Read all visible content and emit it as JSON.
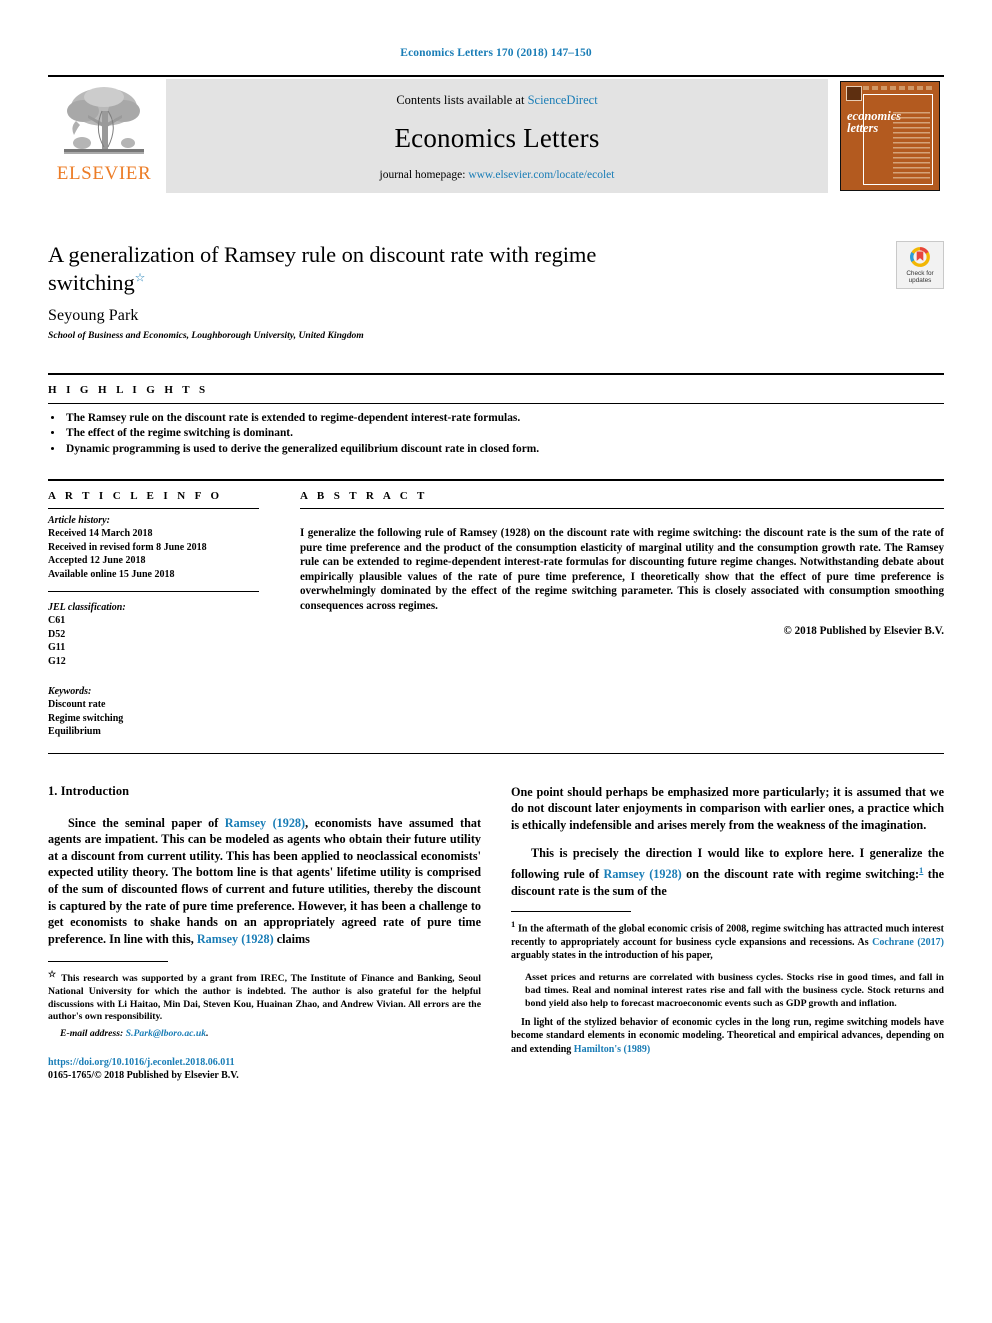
{
  "running_head": "Economics Letters 170 (2018) 147–150",
  "masthead": {
    "publisher_name": "ELSEVIER",
    "contents_prefix": "Contents lists available at",
    "contents_link": "ScienceDirect",
    "journal_title": "Economics Letters",
    "homepage_prefix": "journal homepage:",
    "homepage_link": "www.elsevier.com/locate/ecolet",
    "cover_title_line1": "economics",
    "cover_title_line2": "letters"
  },
  "article": {
    "title": "A generalization of Ramsey rule on discount rate with regime switching",
    "title_star": "☆",
    "author": "Seyoung Park",
    "affiliation": "School of Business and Economics, Loughborough University, United Kingdom",
    "crossmark_line1": "Check for",
    "crossmark_line2": "updates"
  },
  "highlights": {
    "heading": "H I G H L I G H T S",
    "items": [
      "The Ramsey rule on the discount rate is extended to regime-dependent interest-rate formulas.",
      "The effect of the regime switching is dominant.",
      "Dynamic programming is used to derive the generalized equilibrium discount rate in closed form."
    ]
  },
  "article_info": {
    "heading": "A R T I C L E    I N F O",
    "history_label": "Article history:",
    "history": [
      "Received 14 March 2018",
      "Received in revised form 8 June 2018",
      "Accepted 12 June 2018",
      "Available online 15 June 2018"
    ],
    "jel_label": "JEL classification:",
    "jel_codes": [
      "C61",
      "D52",
      "G11",
      "G12"
    ],
    "keywords_label": "Keywords:",
    "keywords": [
      "Discount rate",
      "Regime switching",
      "Equilibrium"
    ]
  },
  "abstract": {
    "heading": "A B S T R A C T",
    "text": "I generalize the following rule of Ramsey (1928) on the discount rate with regime switching: the discount rate is the sum of the rate of pure time preference and the product of the consumption elasticity of marginal utility and the consumption growth rate. The Ramsey rule can be extended to regime-dependent interest-rate formulas for discounting future regime changes. Notwithstanding debate about empirically plausible values of the rate of pure time preference, I theoretically show that the effect of pure time preference is overwhelmingly dominated by the effect of the regime switching parameter. This is closely associated with consumption smoothing consequences across regimes.",
    "copyright": "© 2018 Published by Elsevier B.V."
  },
  "body": {
    "section_heading": "1. Introduction",
    "left_paragraph_parts": {
      "p1_a": "Since the seminal paper of ",
      "p1_cite_author": "Ramsey",
      "p1_cite_year": "(1928)",
      "p1_b": ", economists have assumed that agents are impatient. This can be modeled as agents who obtain their future utility at a discount from current utility. This has been applied to neoclassical economists' expected utility theory. The bottom line is that agents' lifetime utility is comprised of the sum of discounted flows of current and future utilities, thereby the discount is captured by the rate of pure time preference. However, it has been a challenge to get economists to shake hands on an appropriately agreed rate of pure time preference. In line with this, ",
      "p1_cite2_author": "Ramsey",
      "p1_cite2_year": "(1928)",
      "p1_c": " claims"
    },
    "right_quote": "One point should perhaps be emphasized more particularly; it is assumed that we do not discount later enjoyments in comparison with earlier ones, a practice which is ethically indefensible and arises merely from the weakness of the imagination.",
    "right_paragraph_parts": {
      "p2_a": "This is precisely the direction I would like to explore here. I generalize the following rule of ",
      "p2_cite_author": "Ramsey",
      "p2_cite_year": "(1928)",
      "p2_b": " on the discount rate with regime switching:",
      "p2_note": "1",
      "p2_c": " the discount rate is the sum of the"
    }
  },
  "footnotes": {
    "left_star_marker": "☆",
    "left_star_text": "This research was supported by a grant from IREC, The Institute of Finance and Banking, Seoul National University for which the author is indebted. The author is also grateful for the helpful discussions with Li Haitao, Min Dai, Steven Kou, Huainan Zhao, and Andrew Vivian. All errors are the author's own responsibility.",
    "email_label": "E-mail address:",
    "email": "S.Park@lboro.ac.uk",
    "doi": "https://doi.org/10.1016/j.econlet.2018.06.011",
    "issn_line": "0165-1765/© 2018 Published by Elsevier B.V.",
    "right_marker": "1",
    "right_text_a": "In the aftermath of the global economic crisis of 2008, regime switching has attracted much interest recently to appropriately account for business cycle expansions and recessions. As ",
    "right_cite_author": "Cochrane",
    "right_cite_year": "(2017)",
    "right_text_b": " arguably states in the introduction of his paper,",
    "right_quote": "Asset prices and returns are correlated with business cycles. Stocks rise in good times, and fall in bad times. Real and nominal interest rates rise and fall with the business cycle. Stock returns and bond yield also help to forecast macroeconomic events such as GDP growth and inflation.",
    "right_text_c_a": "In light of the stylized behavior of economic cycles in the long run, regime switching models have become standard elements in economic modeling. Theoretical and empirical advances, depending on and extending ",
    "right_cite2_author": "Hamilton's",
    "right_cite2_year": "(1989)"
  },
  "colors": {
    "link_blue": "#1a7db6",
    "elsevier_orange": "#ec7c26",
    "band_gray": "#e3e3e3",
    "cover_orange": "#b35a1f"
  }
}
